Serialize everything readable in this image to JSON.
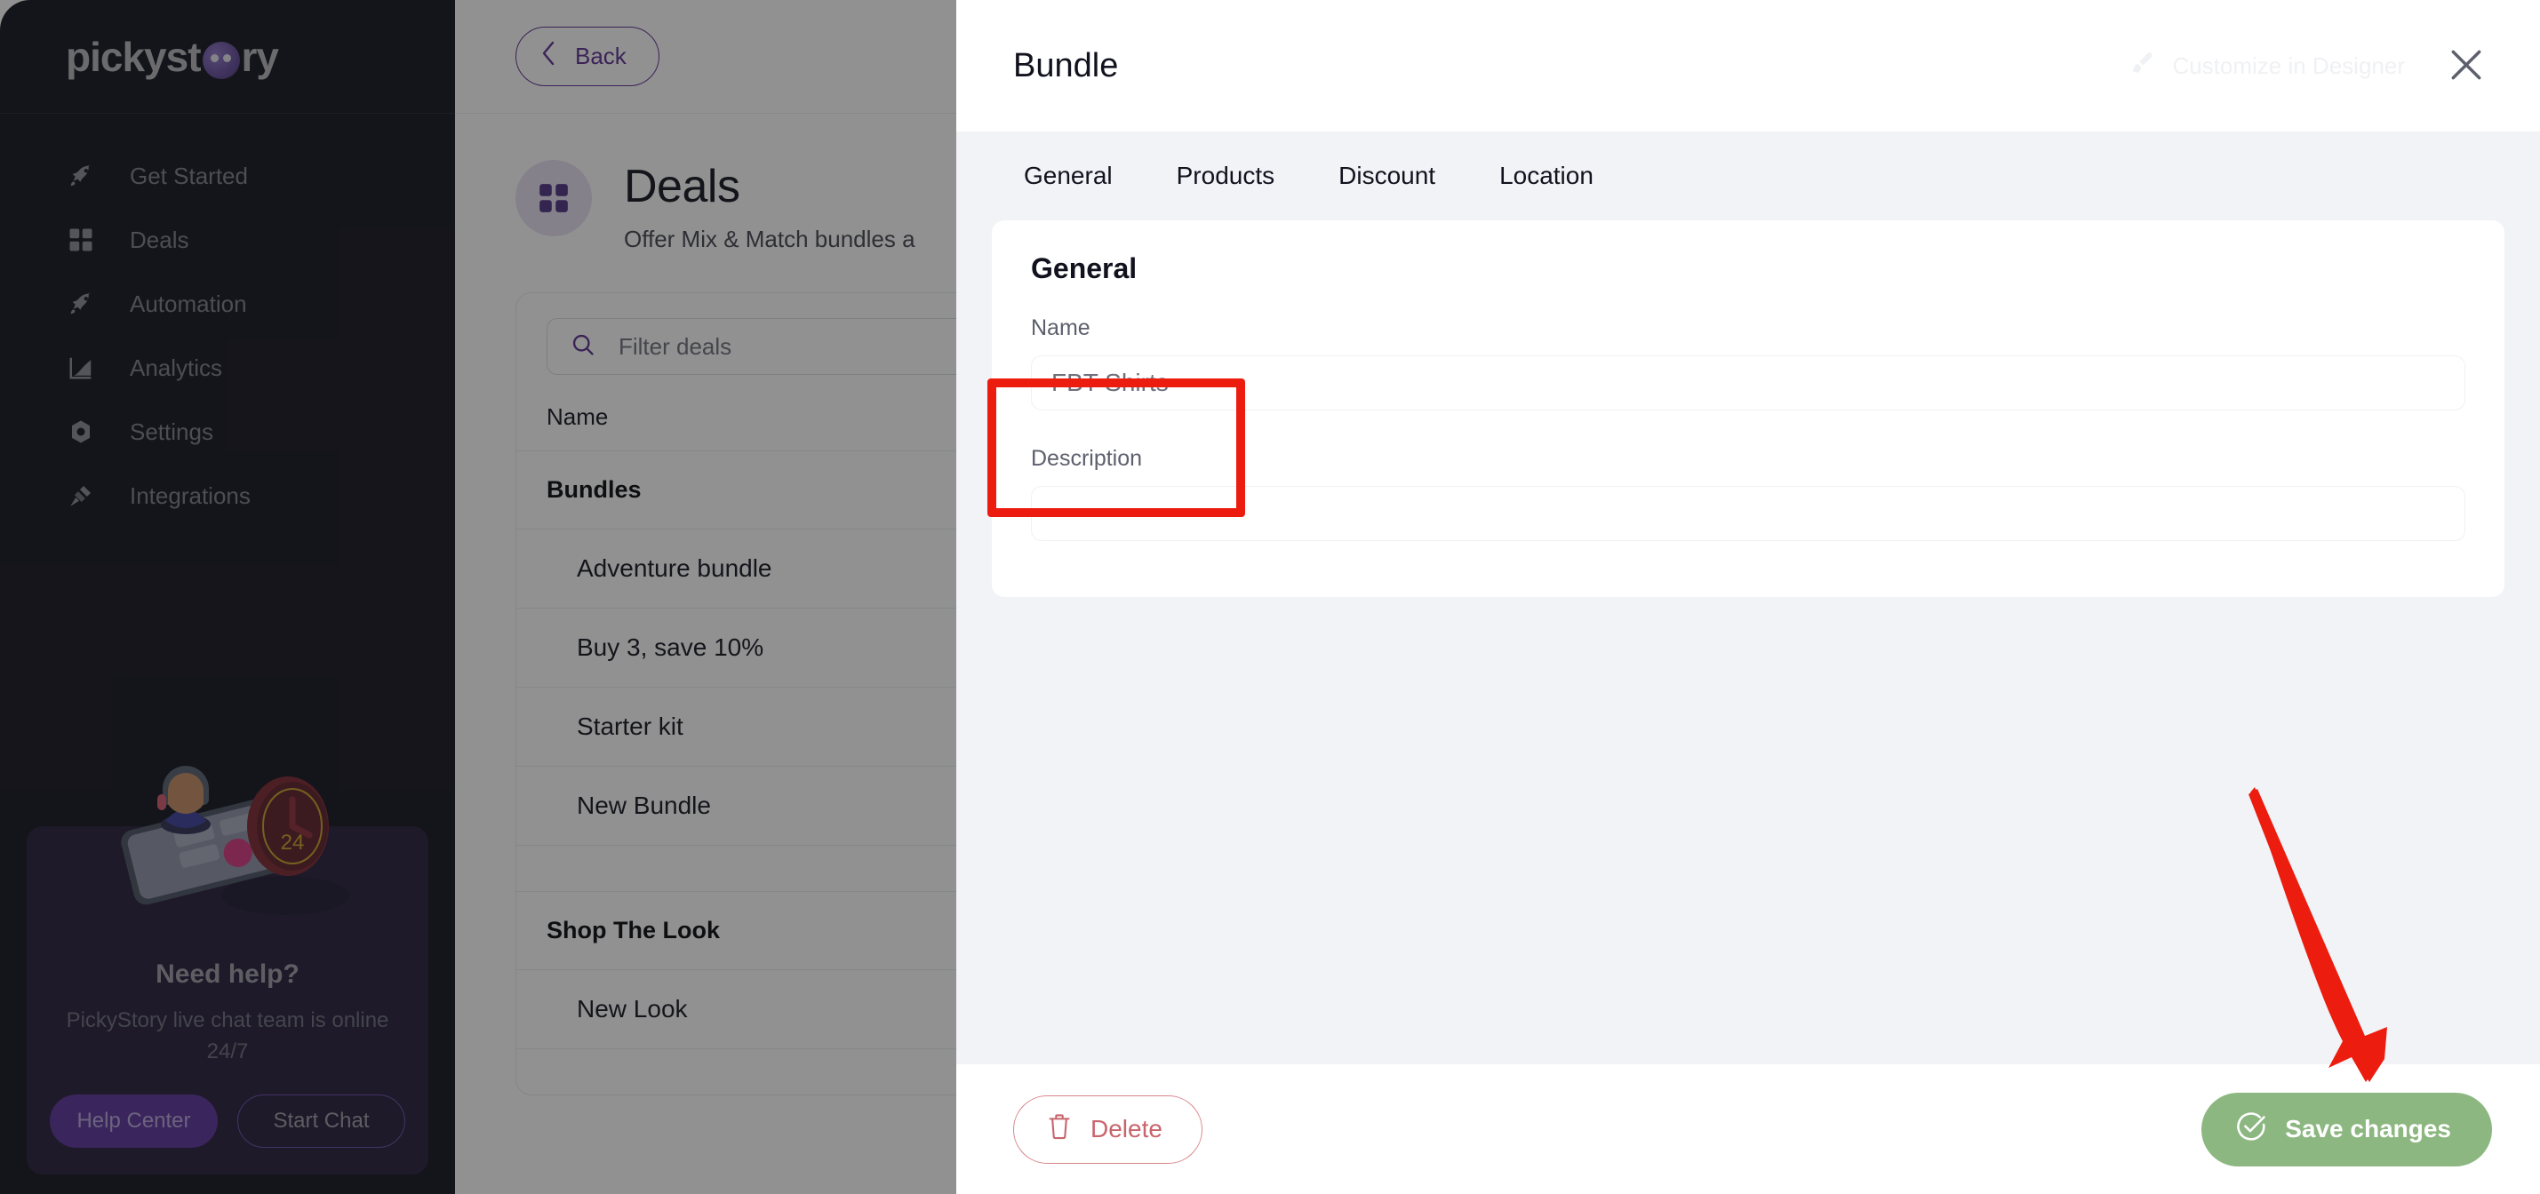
{
  "brand": {
    "name": "pickystory",
    "accent": "#5b2d91",
    "logo_mark": "skull-icon"
  },
  "sidebar": {
    "items": [
      {
        "label": "Get Started",
        "icon": "rocket-icon"
      },
      {
        "label": "Deals",
        "icon": "grid-icon"
      },
      {
        "label": "Automation",
        "icon": "rocket-icon"
      },
      {
        "label": "Analytics",
        "icon": "chart-icon"
      },
      {
        "label": "Settings",
        "icon": "gear-icon"
      },
      {
        "label": "Integrations",
        "icon": "plug-icon"
      }
    ],
    "help": {
      "title": "Need help?",
      "subtitle": "PickyStory live chat team is online 24/7",
      "help_center_label": "Help Center",
      "start_chat_label": "Start Chat",
      "illustration": "support-agent-illustration"
    }
  },
  "main": {
    "back_label": "Back",
    "page_title": "Deals",
    "page_subtitle": "Offer Mix & Match bundles a",
    "page_icon": "grid-icon",
    "filter_placeholder": "Filter deals",
    "column_header": "Name",
    "groups": [
      {
        "title": "Bundles",
        "rows": [
          "Adventure bundle",
          "Buy 3, save 10%",
          "Starter kit",
          "New Bundle"
        ]
      },
      {
        "title": "Shop The Look",
        "rows": [
          "New Look"
        ]
      }
    ]
  },
  "modal": {
    "title": "Bundle",
    "customize_label": "Customize in Designer",
    "customize_icon": "brush-icon",
    "close_icon": "close-icon",
    "tabs": [
      {
        "label": "General",
        "active": true
      },
      {
        "label": "Products",
        "active": false
      },
      {
        "label": "Discount",
        "active": false
      },
      {
        "label": "Location",
        "active": false
      }
    ],
    "form": {
      "section_title": "General",
      "name_label": "Name",
      "name_value": "FBT Shirts",
      "description_label": "Description",
      "description_value": ""
    },
    "footer": {
      "delete_label": "Delete",
      "delete_icon": "trash-icon",
      "save_label": "Save changes",
      "save_icon": "check-circle-icon",
      "save_color": "#8cb780",
      "delete_color": "#c8656c"
    }
  },
  "annotations": {
    "highlight_color": "#ec1c0e",
    "box_target": "name-field-group",
    "arrow_target": "save-changes-button"
  }
}
